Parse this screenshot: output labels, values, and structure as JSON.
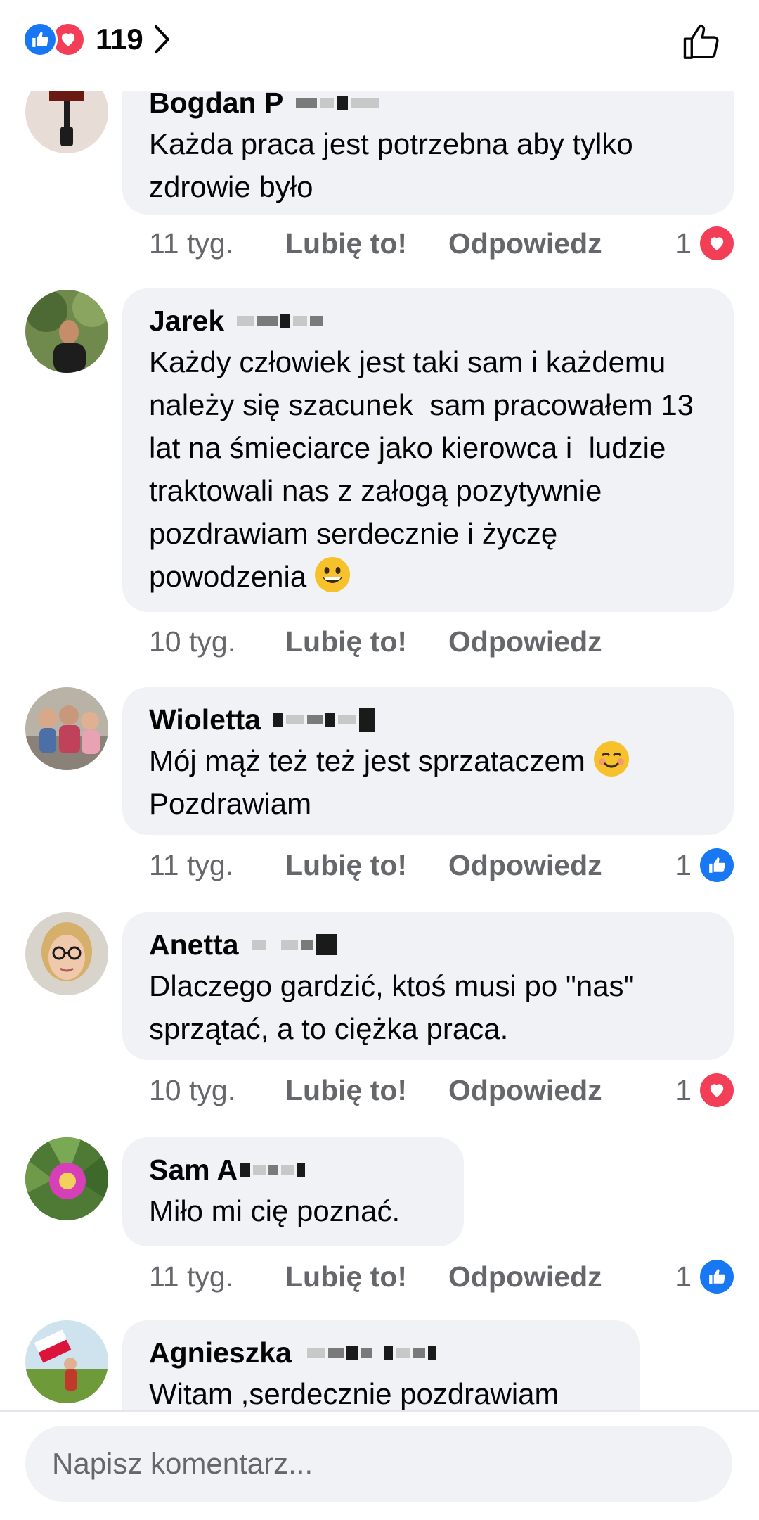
{
  "header": {
    "reaction_count": "119",
    "reaction_icons": [
      "like-icon",
      "love-icon"
    ],
    "colors": {
      "like": "#1877F2",
      "love": "#F33E58"
    }
  },
  "comments": [
    {
      "author": "Bogdan P",
      "text": "Każda praca jest potrzebna aby tylko zdrowie było",
      "time": "11 tyg.",
      "like_label": "Lubię to!",
      "reply_label": "Odpowiedz",
      "reaction_count": "1",
      "reaction": "love"
    },
    {
      "author": "Jarek",
      "text": "Każdy człowiek jest taki sam i każdemu należy się szacunek  sam pracowałem 13 lat na śmieciarce jako kierowca i  ludzie traktowali nas z załogą pozytywnie pozdrawiam serdecznie i życzę powodzenia",
      "emoji": "grinning-face",
      "time": "10 tyg.",
      "like_label": "Lubię to!",
      "reply_label": "Odpowiedz"
    },
    {
      "author": "Wioletta",
      "text": "Mój mąż też też jest sprzataczem",
      "text2": "Pozdrawiam",
      "emoji": "smiling-face",
      "time": "11 tyg.",
      "like_label": "Lubię to!",
      "reply_label": "Odpowiedz",
      "reaction_count": "1",
      "reaction": "like"
    },
    {
      "author": "Anetta",
      "text": "Dlaczego gardzić, ktoś musi po \"nas\" sprzątać, a to ciężka praca.",
      "time": "10 tyg.",
      "like_label": "Lubię to!",
      "reply_label": "Odpowiedz",
      "reaction_count": "1",
      "reaction": "love"
    },
    {
      "author": "Sam A",
      "text": "Miło mi cię poznać.",
      "time": "11 tyg.",
      "like_label": "Lubię to!",
      "reply_label": "Odpowiedz",
      "reaction_count": "1",
      "reaction": "like"
    },
    {
      "author": "Agnieszka",
      "text": "Witam ,serdecznie pozdrawiam"
    }
  ],
  "composer": {
    "placeholder": "Napisz komentarz..."
  }
}
